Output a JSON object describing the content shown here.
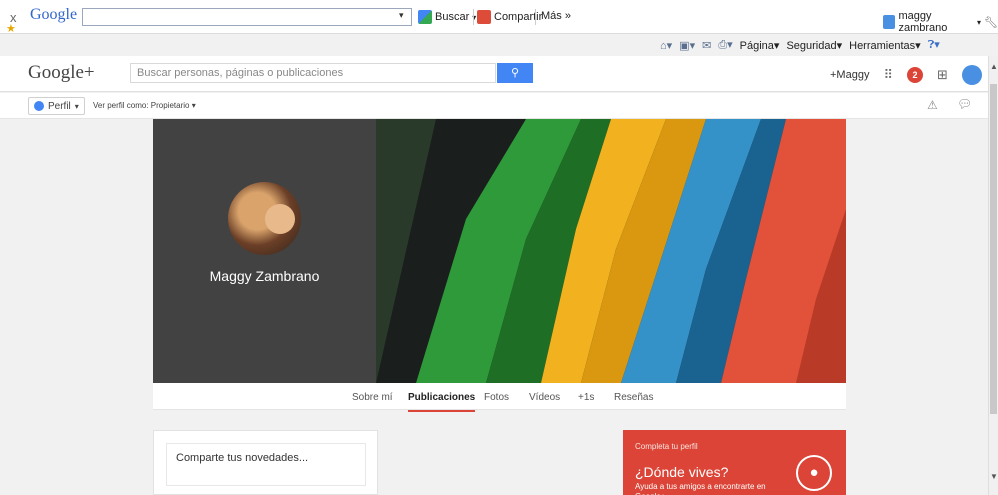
{
  "browser_toolbar": {
    "close": "x",
    "logo": "Google",
    "search_value": "",
    "search_btn": "Buscar",
    "share_btn": "Compartir",
    "more_btn": "Más »",
    "user": "maggy zambrano"
  },
  "command_bar": {
    "page": "Página",
    "security": "Seguridad",
    "tools": "Herramientas"
  },
  "gplus": {
    "logo": "Google+",
    "search_placeholder": "Buscar personas, páginas o publicaciones",
    "user_link": "+Maggy",
    "notif_count": "2"
  },
  "subbar": {
    "profile_btn": "Perfil",
    "view_as": "Ver perfil como: Propietario"
  },
  "profile": {
    "name": "Maggy Zambrano"
  },
  "tabs": [
    {
      "label": "Sobre mí",
      "active": false
    },
    {
      "label": "Publicaciones",
      "active": true
    },
    {
      "label": "Fotos",
      "active": false
    },
    {
      "label": "Vídeos",
      "active": false
    },
    {
      "label": "+1s",
      "active": false
    },
    {
      "label": "Reseñas",
      "active": false
    }
  ],
  "share": {
    "placeholder": "Comparte tus novedades..."
  },
  "complete_profile": {
    "heading": "Completa tu perfil",
    "question": "¿Dónde vives?",
    "description": "Ayuda a tus amigos a encontrarte en Google+"
  },
  "colors": {
    "accent_red": "#db4437",
    "accent_blue": "#4285f4",
    "cover_dark": "#424242"
  }
}
